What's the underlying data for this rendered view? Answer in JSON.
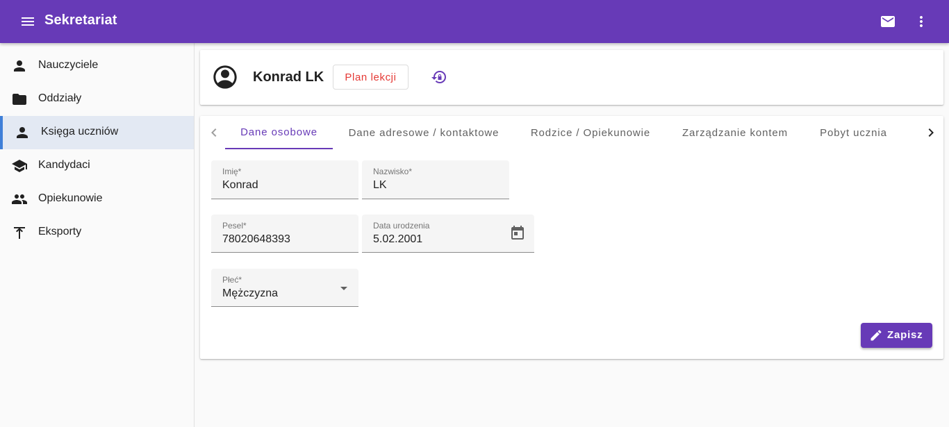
{
  "app": {
    "title": "Sekretariat"
  },
  "topbar": {
    "icons": [
      "menu-icon",
      "mail-icon",
      "more-vert-icon"
    ]
  },
  "sidebar": {
    "items": [
      {
        "label": "Nauczyciele",
        "icon": "person-icon",
        "active": false
      },
      {
        "label": "Oddziały",
        "icon": "folder-icon",
        "active": false
      },
      {
        "label": "Księga uczniów",
        "icon": "person-icon",
        "active": true
      },
      {
        "label": "Kandydaci",
        "icon": "school-icon",
        "active": false
      },
      {
        "label": "Opiekunowie",
        "icon": "people-icon",
        "active": false
      },
      {
        "label": "Eksporty",
        "icon": "upload-icon",
        "active": false
      }
    ]
  },
  "header": {
    "name": "Konrad LK",
    "plan_button": "Plan lekcji",
    "icons": [
      "account-circle-icon",
      "lock-reset-icon"
    ]
  },
  "tabs": [
    {
      "label": "Dane osobowe",
      "active": true
    },
    {
      "label": "Dane adresowe / kontaktowe",
      "active": false
    },
    {
      "label": "Rodzice / Opiekunowie",
      "active": false
    },
    {
      "label": "Zarządzanie kontem",
      "active": false
    },
    {
      "label": "Pobyt ucznia",
      "active": false
    }
  ],
  "form": {
    "first_name": {
      "label": "Imię*",
      "value": "Konrad"
    },
    "last_name": {
      "label": "Nazwisko*",
      "value": "LK"
    },
    "pesel": {
      "label": "Pesel*",
      "value": "78020648393"
    },
    "birth_date": {
      "label": "Data urodzenia",
      "value": "5.02.2001"
    },
    "gender": {
      "label": "Płeć*",
      "value": "Mężczyzna"
    }
  },
  "actions": {
    "save": "Zapisz"
  },
  "colors": {
    "primary": "#673ab7",
    "accent_red": "#e53935",
    "active_nav_bg": "#e3e9f3"
  }
}
